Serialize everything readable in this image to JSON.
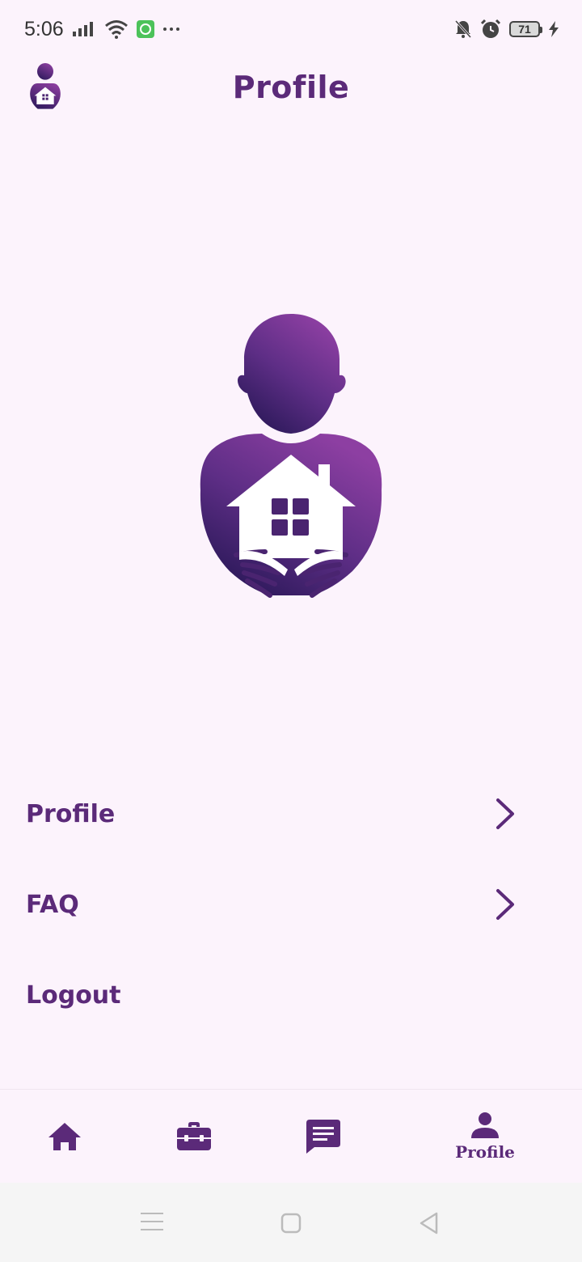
{
  "status_bar": {
    "time": "5:06",
    "battery_level": "71",
    "icons": [
      "signal-icon",
      "wifi-icon",
      "whatsapp-icon",
      "more-icon",
      "bell-off-icon",
      "alarm-icon",
      "battery-icon",
      "charging-icon"
    ]
  },
  "header": {
    "title": "Profile"
  },
  "menu": {
    "items": [
      {
        "label": "Profile",
        "has_chevron": true
      },
      {
        "label": "FAQ",
        "has_chevron": true
      },
      {
        "label": "Logout",
        "has_chevron": false
      }
    ]
  },
  "bottom_nav": {
    "items": [
      {
        "icon": "home-icon",
        "label": ""
      },
      {
        "icon": "briefcase-icon",
        "label": ""
      },
      {
        "icon": "chat-icon",
        "label": ""
      },
      {
        "icon": "person-icon",
        "label": "Profile",
        "active": true
      }
    ]
  },
  "colors": {
    "primary": "#5b2a79",
    "background": "#fcf3fc",
    "logo_gradient_top": "#8a3d9e",
    "logo_gradient_bottom": "#2d1a5c"
  }
}
